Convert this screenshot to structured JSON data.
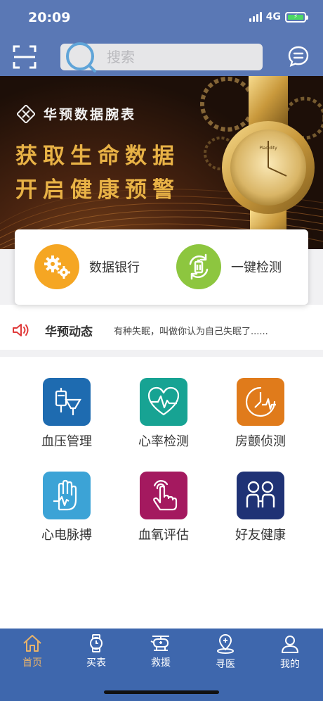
{
  "status_bar": {
    "time": "20:09",
    "network": "4G"
  },
  "header": {
    "search_placeholder": "搜索",
    "icons": {
      "scan": "scan-icon",
      "search": "search-icon",
      "message": "message-icon"
    }
  },
  "banner": {
    "brand": "华预数据腕表",
    "slogan_line1": "获取生命数据",
    "slogan_line2": "开启健康预警",
    "watch_brand": "Placidity"
  },
  "quick_actions": [
    {
      "label": "数据银行",
      "icon": "gears-icon",
      "color": "#f5a623"
    },
    {
      "label": "一键检测",
      "icon": "refresh-battery-icon",
      "color": "#8dc63f"
    }
  ],
  "news": {
    "title": "华预动态",
    "text": "有种失眠，叫做你认为自己失眠了......",
    "icon": "speaker-icon"
  },
  "features": [
    {
      "label": "血压管理",
      "icon": "blood-pressure-icon",
      "color": "#1e6bb0"
    },
    {
      "label": "心率检测",
      "icon": "heart-rate-icon",
      "color": "#17a393"
    },
    {
      "label": "房颤侦测",
      "icon": "clock-pulse-icon",
      "color": "#e07b1b"
    },
    {
      "label": "心电脉搏",
      "icon": "hand-pulse-icon",
      "color": "#3ca3d6"
    },
    {
      "label": "血氧评估",
      "icon": "touch-icon",
      "color": "#a4195f"
    },
    {
      "label": "好友健康",
      "icon": "friends-icon",
      "color": "#1f3275"
    }
  ],
  "tabbar": {
    "active_color": "#e9b36a",
    "items": [
      {
        "label": "首页",
        "icon": "home-icon",
        "active": true
      },
      {
        "label": "买表",
        "icon": "watch-icon",
        "active": false
      },
      {
        "label": "救援",
        "icon": "helicopter-icon",
        "active": false
      },
      {
        "label": "寻医",
        "icon": "doctor-location-icon",
        "active": false
      },
      {
        "label": "我的",
        "icon": "user-icon",
        "active": false
      }
    ]
  }
}
